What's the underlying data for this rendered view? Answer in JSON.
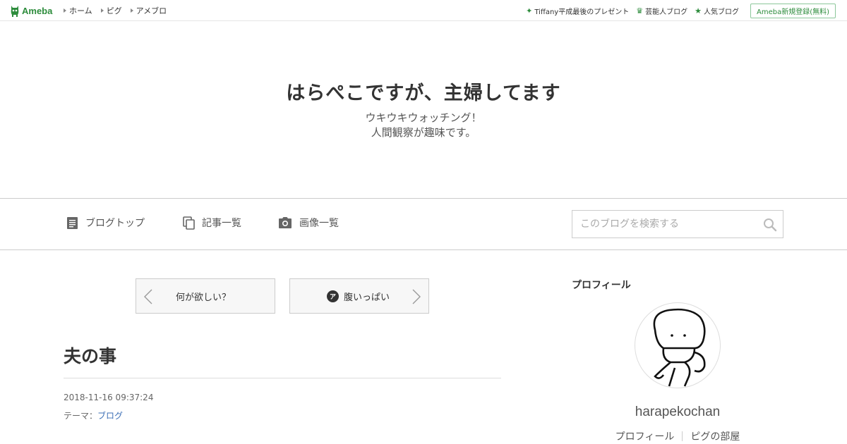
{
  "topbar": {
    "logo_text": "Ameba",
    "nav_left": [
      "ホーム",
      "ピグ",
      "アメブロ"
    ],
    "nav_right": [
      {
        "icon": "sparkle-icon",
        "label": "Tiffany平成最後のプレゼント"
      },
      {
        "icon": "crown-icon",
        "label": "芸能人ブログ"
      },
      {
        "icon": "star-icon",
        "label": "人気ブログ"
      }
    ],
    "register_label": "Ameba新規登録(無料)"
  },
  "header": {
    "title": "はらぺこですが、主婦してます",
    "desc_line1": "ウキウキウォッチング！",
    "desc_line2": "人間観察が趣味です。"
  },
  "blognav": {
    "top_label": "ブログトップ",
    "list_label": "記事一覧",
    "images_label": "画像一覧",
    "search_placeholder": "このブログを検索する"
  },
  "pager": {
    "prev_label": "何が欲しい？",
    "next_label": "腹いっぱい",
    "next_badge": "ア"
  },
  "article": {
    "title": "夫の事",
    "date": "2018-11-16 09:37:24",
    "theme_prefix": "テーマ：",
    "theme_link": "ブログ"
  },
  "sidebar": {
    "heading": "プロフィール",
    "username": "harapekochan",
    "link_profile": "プロフィール",
    "link_room": "ピグの部屋"
  },
  "colors": {
    "ameba_green": "#2d8c3c",
    "link_blue": "#3c6fb6"
  }
}
